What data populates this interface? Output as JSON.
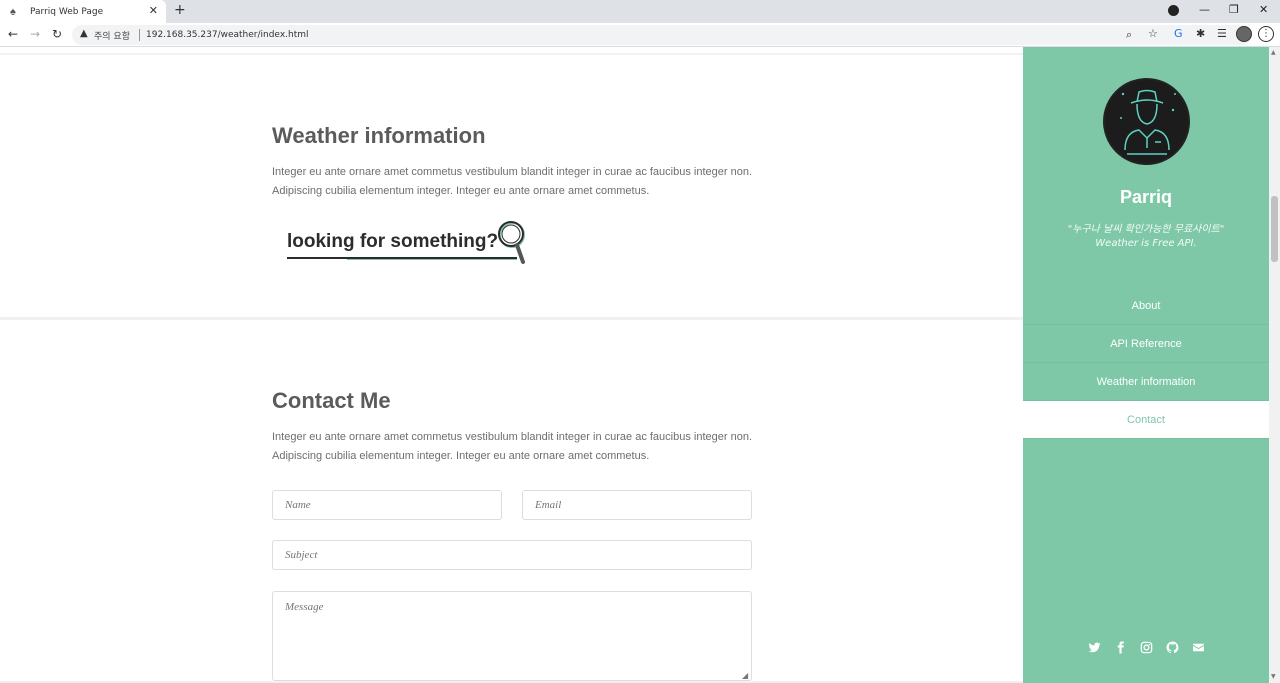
{
  "browser": {
    "tab_title": "Parriq Web Page",
    "tab_close": "✕",
    "new_tab": "+",
    "security_warning": "주의 요함",
    "url": "192.168.35.237/weather/index.html"
  },
  "weather_section": {
    "heading": "Weather information",
    "paragraph": "Integer eu ante ornare amet commetus vestibulum blandit integer in curae ac faucibus integer non. Adipiscing cubilia elementum integer. Integer eu ante ornare amet commetus.",
    "search_prompt": "looking for something?"
  },
  "contact_section": {
    "heading": "Contact Me",
    "paragraph": "Integer eu ante ornare amet commetus vestibulum blandit integer in curae ac faucibus integer non. Adipiscing cubilia elementum integer. Integer eu ante ornare amet commetus.",
    "form": {
      "name_placeholder": "Name",
      "email_placeholder": "Email",
      "subject_placeholder": "Subject",
      "message_placeholder": "Message"
    }
  },
  "sidebar": {
    "brand": "Parriq",
    "tagline_line1": "\"누구나 날씨 확인가능한 무료사이트\"",
    "tagline_line2": "Weather is Free API.",
    "nav": [
      "About",
      "API Reference",
      "Weather information",
      "Contact"
    ],
    "active_nav": "Contact",
    "socials": [
      "twitter-icon",
      "facebook-icon",
      "instagram-icon",
      "github-icon",
      "envelope-icon"
    ]
  },
  "colors": {
    "accent": "#7ec8a8",
    "heading": "#5b5b5b",
    "text": "#6e6e6e"
  }
}
